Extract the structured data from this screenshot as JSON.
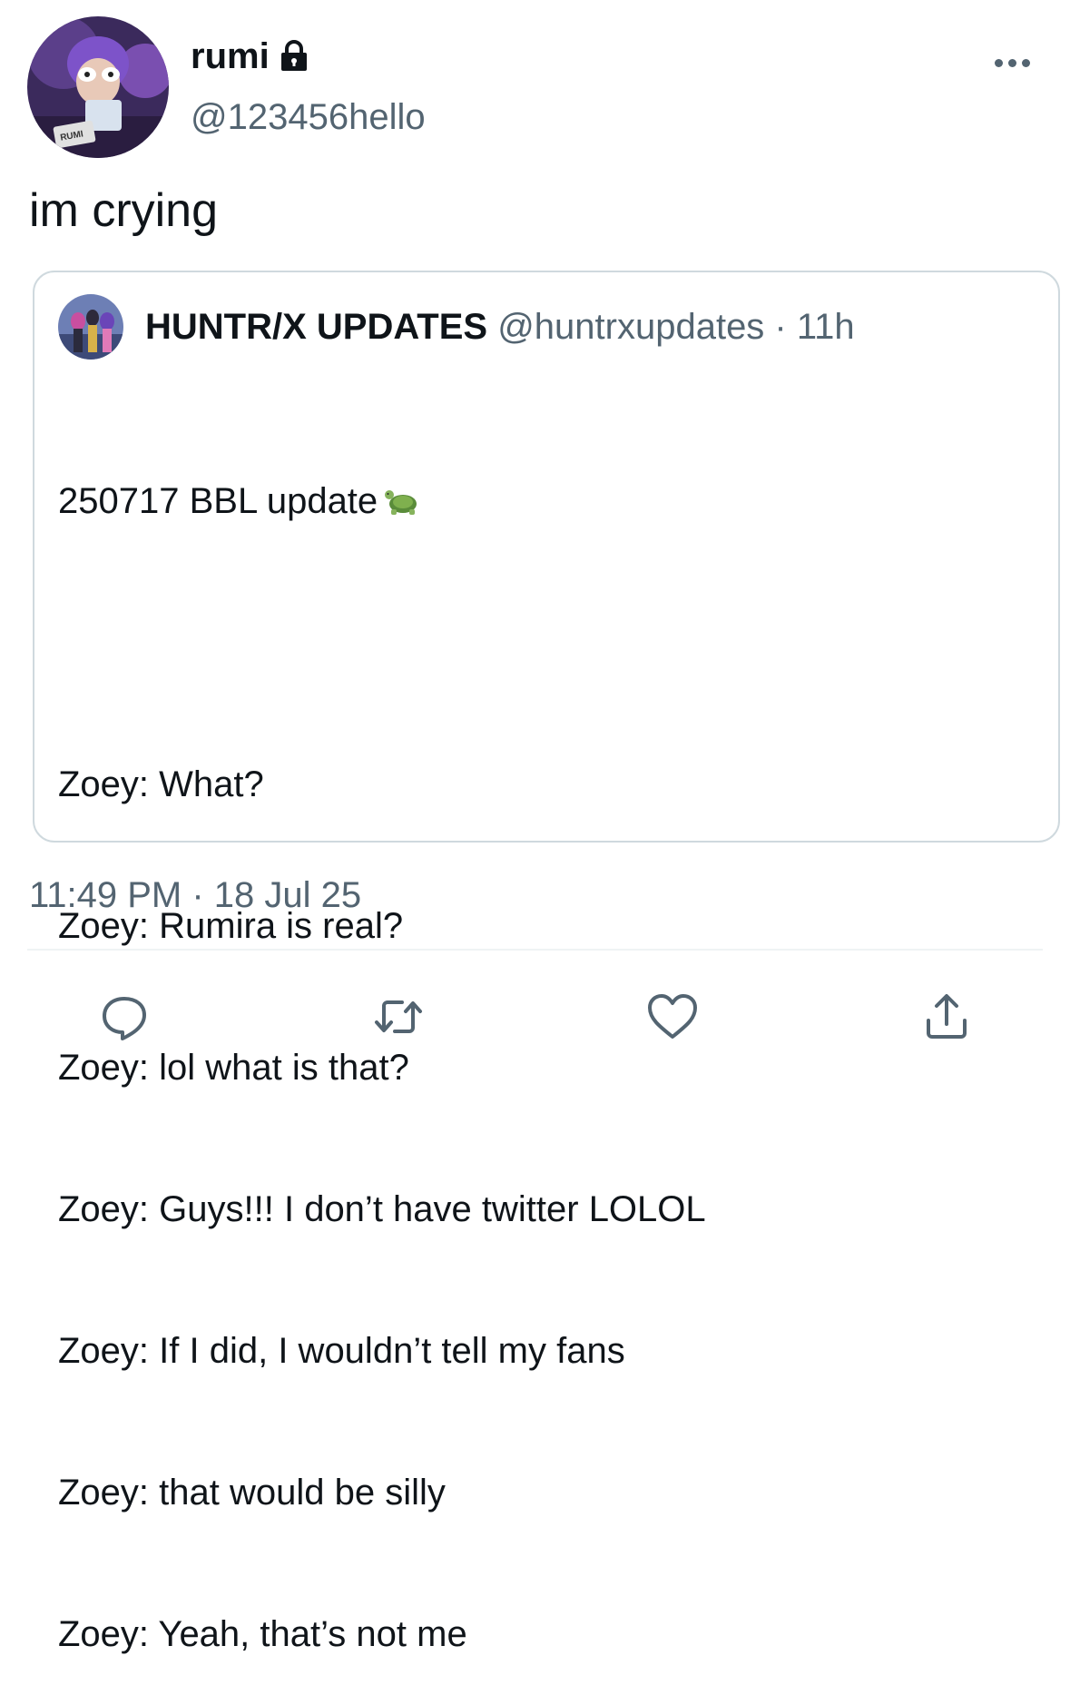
{
  "author": {
    "display_name": "rumi",
    "handle": "@123456hello",
    "avatar_badge_text": "RUMI"
  },
  "tweet": {
    "text": "im crying",
    "timestamp": "11:49 PM · 18 Jul 25"
  },
  "quoted": {
    "name": "HUNTR/X UPDATES",
    "meta": "@huntrxupdates · 11h",
    "lines": [
      "250717 BBL update",
      "",
      "Zoey: What?",
      "Zoey: Rumira is real?",
      "Zoey: lol what is that?",
      "Zoey: Guys!!! I don’t have twitter LOLOL",
      "Zoey: If I did, I wouldn’t tell my fans",
      "Zoey: that would be silly",
      "Zoey: Yeah, that’s not me"
    ],
    "emoji_icon": "turtle-icon"
  },
  "actions": [
    "reply-icon",
    "retweet-icon",
    "like-icon",
    "share-icon"
  ],
  "colors": {
    "text": "#0f1419",
    "secondary": "#536471",
    "border": "#cfd9de"
  }
}
